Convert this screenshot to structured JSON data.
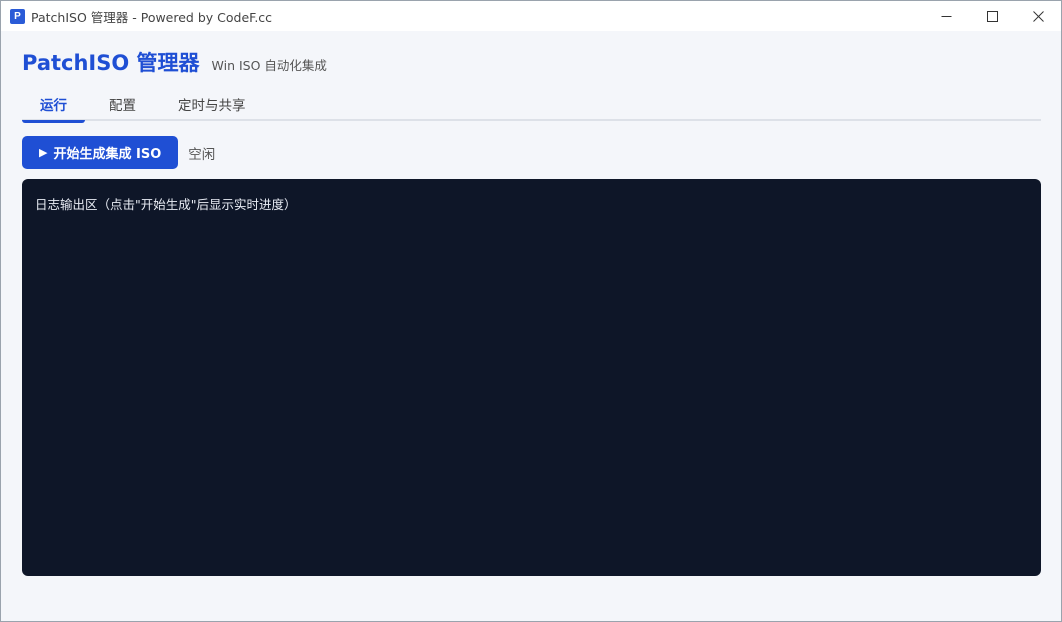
{
  "window": {
    "icon_letter": "P",
    "title": "PatchISO 管理器 - Powered by CodeF.cc"
  },
  "header": {
    "title": "PatchISO 管理器",
    "subtitle": "Win ISO 自动化集成"
  },
  "tabs": [
    {
      "label": "运行",
      "active": true
    },
    {
      "label": "配置",
      "active": false
    },
    {
      "label": "定时与共享",
      "active": false
    }
  ],
  "actions": {
    "start_icon": "▶",
    "start_label": "开始生成集成 ISO",
    "status": "空闲"
  },
  "log": {
    "placeholder": "日志输出区（点击\"开始生成\"后显示实时进度）"
  },
  "colors": {
    "accent": "#1f4fd4",
    "log_background": "#0e1628",
    "page_background": "#f4f6fa"
  }
}
